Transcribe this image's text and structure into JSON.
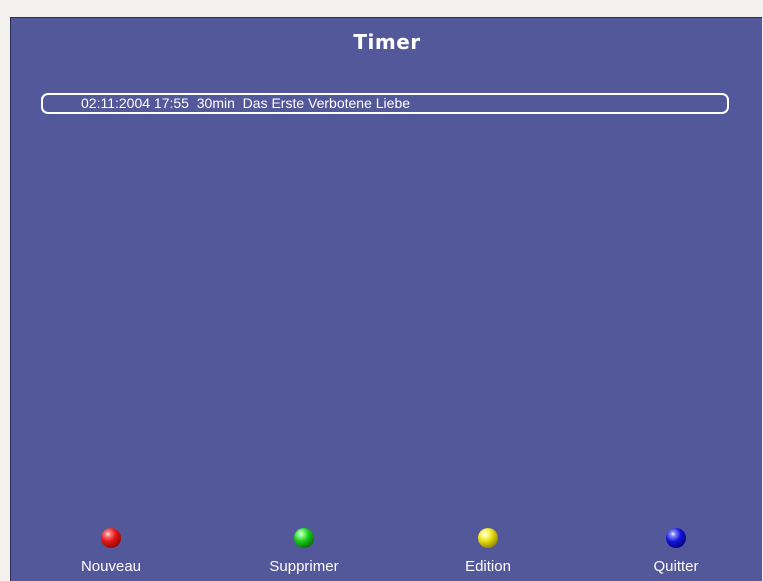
{
  "window": {
    "title": "Timer"
  },
  "timers": [
    {
      "date": "02:11:2004",
      "time": "17:55",
      "duration": "30min",
      "channel": "Das Erste",
      "program": "Verbotene Liebe"
    }
  ],
  "buttons": [
    {
      "label": "Nouveau",
      "color": "#e01818",
      "icon": "red-ball-icon"
    },
    {
      "label": "Supprimer",
      "color": "#19c819",
      "icon": "green-ball-icon"
    },
    {
      "label": "Edition",
      "color": "#e6dc10",
      "icon": "yellow-ball-icon"
    },
    {
      "label": "Quitter",
      "color": "#1414d8",
      "icon": "blue-ball-icon"
    }
  ],
  "colors": {
    "background": "#52589a",
    "text": "#ffffff"
  }
}
